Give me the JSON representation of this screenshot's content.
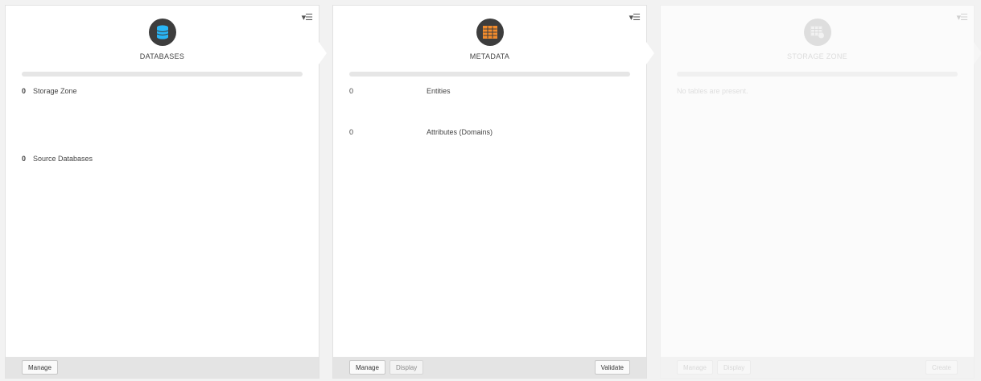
{
  "panels": {
    "databases": {
      "title": "DATABASES",
      "icon": "database-icon",
      "menu_glyph": "▾☰",
      "stats": [
        {
          "value": "0",
          "label": "Storage Zone"
        },
        {
          "value": "0",
          "label": "Source Databases"
        }
      ],
      "footer": {
        "manage": "Manage"
      }
    },
    "metadata": {
      "title": "METADATA",
      "icon": "table-grid-icon",
      "menu_glyph": "▾☰",
      "stats": [
        {
          "value": "0",
          "label": "Entities"
        },
        {
          "value": "0",
          "label": "Attributes (Domains)"
        }
      ],
      "footer": {
        "manage": "Manage",
        "display": "Display",
        "validate": "Validate"
      }
    },
    "storage_zone": {
      "title": "STORAGE ZONE",
      "icon": "storage-tables-icon",
      "menu_glyph": "▾☰",
      "empty_message": "No tables are present.",
      "disabled": true,
      "footer": {
        "manage": "Manage",
        "display": "Display",
        "create": "Create"
      }
    }
  },
  "colors": {
    "icon_dark": "#3d3d3d",
    "database_accent": "#29b6f6",
    "metadata_accent": "#f28b2c",
    "storage_accent": "#d9d9d9"
  }
}
